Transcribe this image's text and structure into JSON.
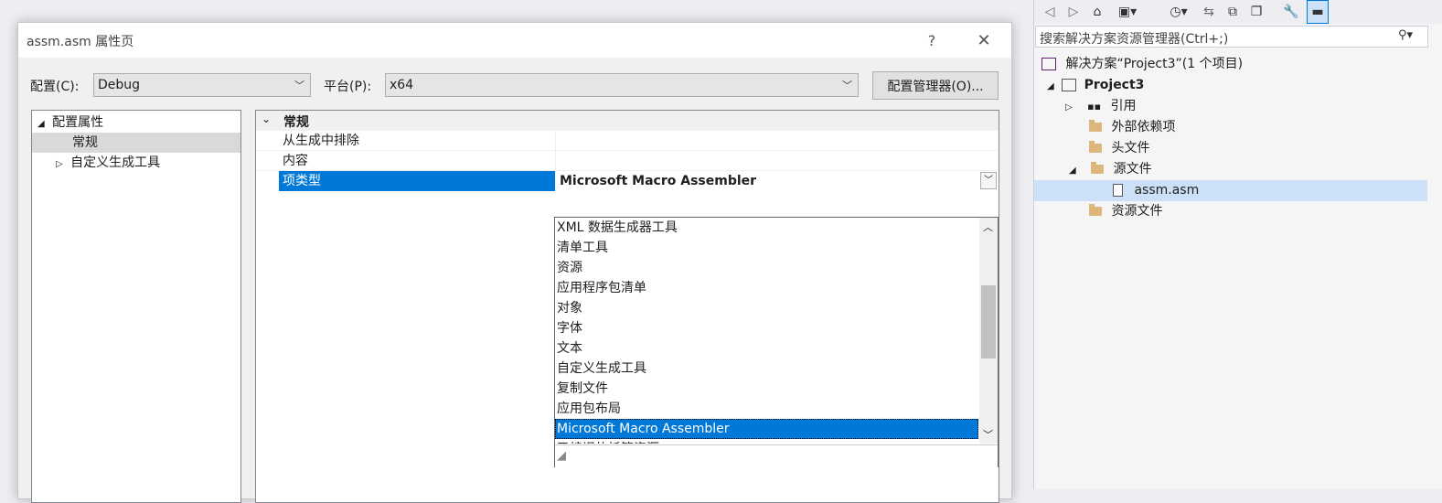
{
  "dialog": {
    "title": "assm.asm 属性页",
    "help": "?",
    "close": "✕",
    "config_label": "配置(C):",
    "config_value": "Debug",
    "platform_label": "平台(P):",
    "platform_value": "x64",
    "config_manager": "配置管理器(O)..."
  },
  "tree": {
    "root": "配置属性",
    "items": [
      {
        "label": "常规"
      },
      {
        "label": "自定义生成工具"
      }
    ]
  },
  "grid": {
    "category": "常规",
    "rows": [
      {
        "name": "从生成中排除",
        "value": ""
      },
      {
        "name": "内容",
        "value": ""
      },
      {
        "name": "项类型",
        "value": "Microsoft Macro Assembler"
      }
    ],
    "options": [
      "XML 数据生成器工具",
      "清单工具",
      "资源",
      "应用程序包清单",
      "对象",
      "字体",
      "文本",
      "自定义生成工具",
      "复制文件",
      "应用包布局",
      "Microsoft Macro Assembler",
      "已编译的托管资源"
    ],
    "selected_option": "Microsoft Macro Assembler"
  },
  "solution_explorer": {
    "search_placeholder": "搜索解决方案资源管理器(Ctrl+;)",
    "solution": "解决方案“Project3”(1 个项目)",
    "project": "Project3",
    "references": "引用",
    "external_deps": "外部依赖项",
    "header_files": "头文件",
    "source_files": "源文件",
    "file": "assm.asm",
    "resource_files": "资源文件"
  },
  "colors": {
    "accent": "#0078d7",
    "tree_selection": "#d9d9d9",
    "se_selection": "#cce1f8"
  }
}
